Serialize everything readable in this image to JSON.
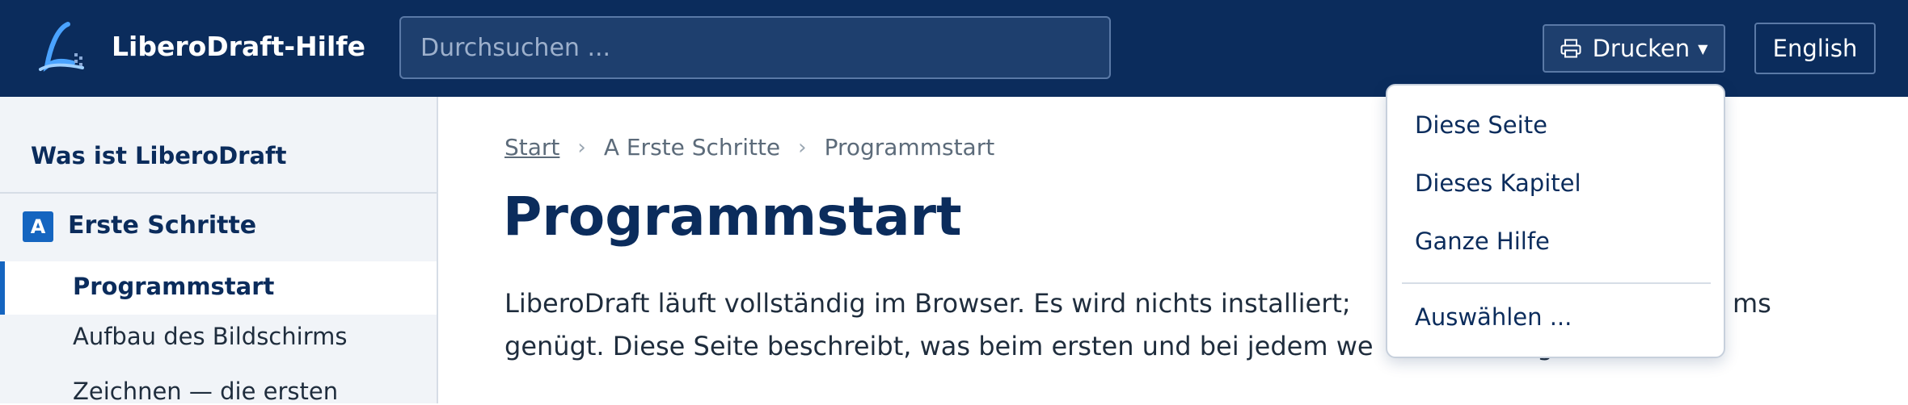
{
  "header": {
    "title": "LiberoDraft-Hilfe",
    "search_placeholder": "Durchsuchen ...",
    "print_label": "Drucken",
    "print_icon": "printer-icon",
    "language_label": "English",
    "colors": {
      "bar": "#0b2c5c",
      "accent": "#1565c0"
    }
  },
  "sidebar": {
    "intro": "Was ist LiberoDraft",
    "chapter_badge": "A",
    "chapter_title": "Erste Schritte",
    "items": [
      "Programmstart",
      "Aufbau des Bildschirms",
      "Zeichnen — die ersten"
    ],
    "active_index": 0
  },
  "breadcrumb": {
    "home": "Start",
    "chapter": "A Erste Schritte",
    "current": "Programmstart"
  },
  "main": {
    "title": "Programmstart",
    "line1": "LiberoDraft läuft vollständig im Browser. Es wird nichts installiert;",
    "line1_end": "ms",
    "line2": "genügt. Diese Seite beschreibt, was beim ersten und bei jedem we",
    "line2_end": "g"
  },
  "print_menu": {
    "items": [
      "Diese Seite",
      "Dieses Kapitel",
      "Ganze Hilfe"
    ],
    "custom": "Auswählen ..."
  }
}
